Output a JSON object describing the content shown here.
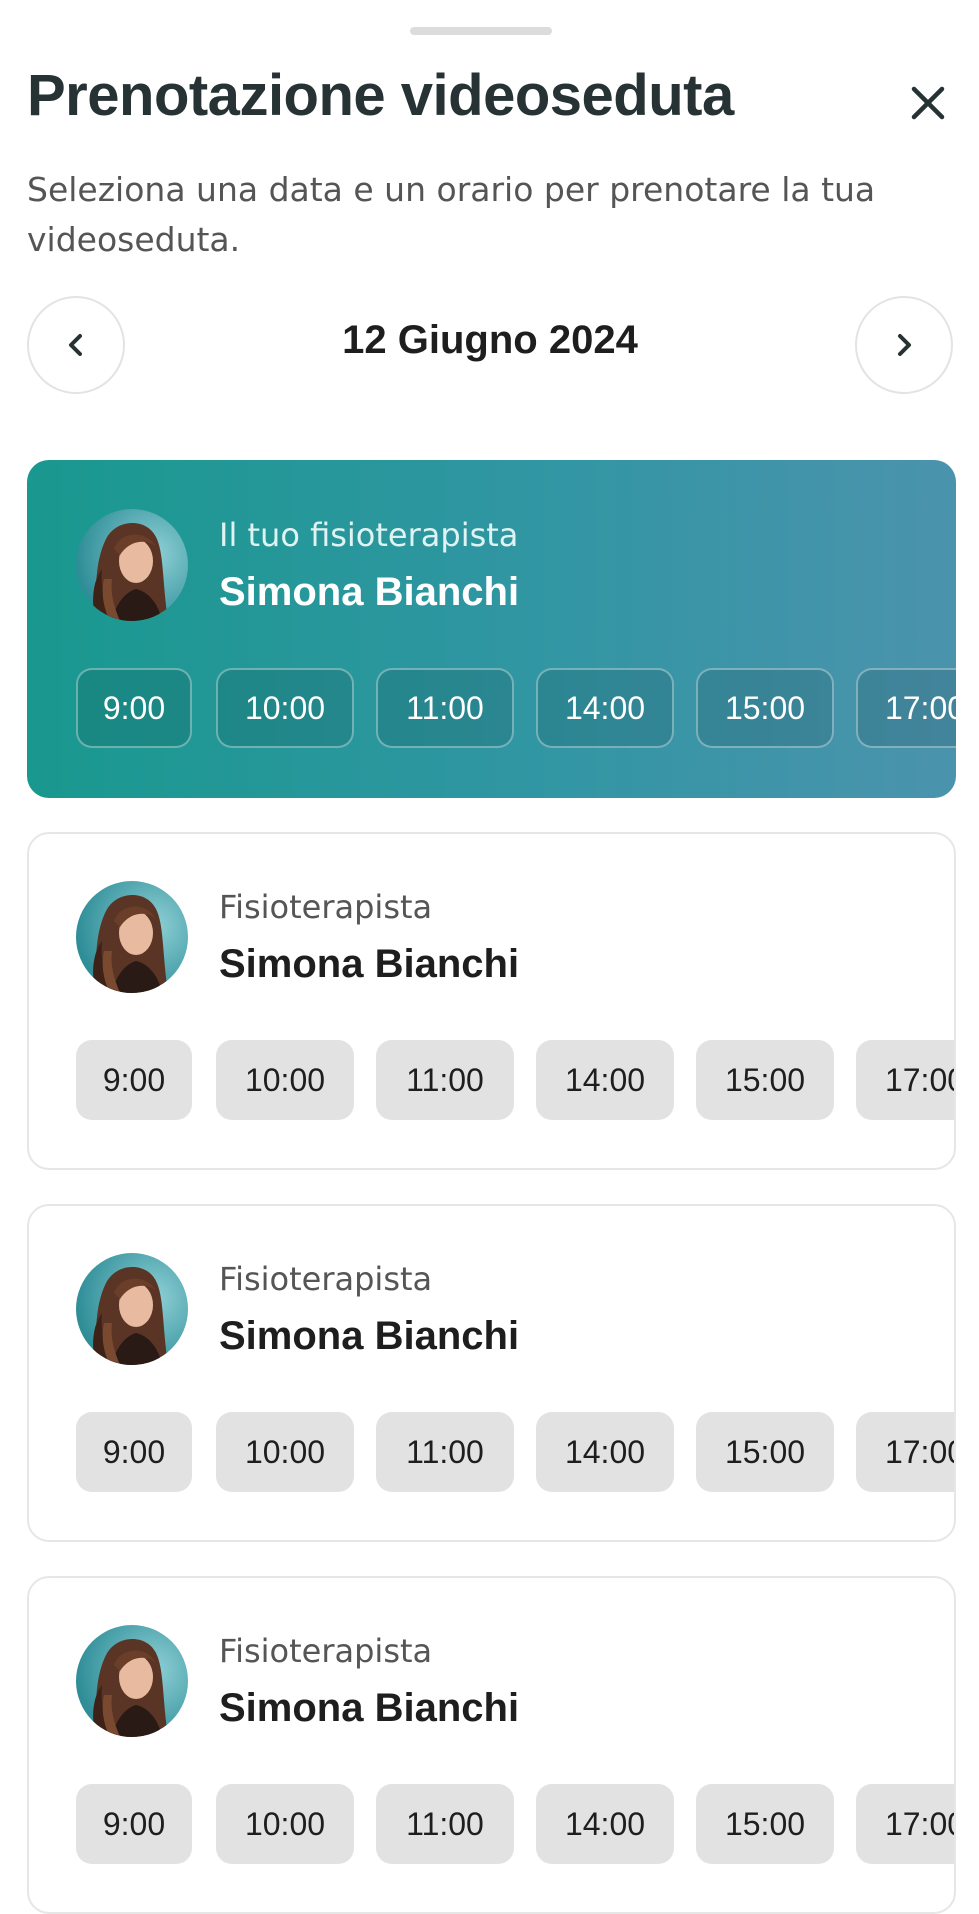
{
  "header": {
    "title": "Prenotazione videoseduta",
    "subtitle": "Seleziona una data e un orario per prenotare la tua videoseduta."
  },
  "date_nav": {
    "date_label": "12 Giugno 2024"
  },
  "cards": [
    {
      "role": "Il tuo fisioterapista",
      "name": "Simona Bianchi",
      "featured": true,
      "slots": [
        "9:00",
        "10:00",
        "11:00",
        "14:00",
        "15:00",
        "17:00"
      ]
    },
    {
      "role": "Fisioterapista",
      "name": "Simona Bianchi",
      "featured": false,
      "slots": [
        "9:00",
        "10:00",
        "11:00",
        "14:00",
        "15:00",
        "17:00"
      ]
    },
    {
      "role": "Fisioterapista",
      "name": "Simona Bianchi",
      "featured": false,
      "slots": [
        "9:00",
        "10:00",
        "11:00",
        "14:00",
        "15:00",
        "17:00"
      ]
    },
    {
      "role": "Fisioterapista",
      "name": "Simona Bianchi",
      "featured": false,
      "slots": [
        "9:00",
        "10:00",
        "11:00",
        "14:00",
        "15:00",
        "17:00"
      ]
    }
  ],
  "colors": {
    "accent_start": "#19988f",
    "accent_end": "#4b93ad",
    "slot_bg": "#e2e2e2"
  },
  "icons": {
    "close": "close-icon",
    "prev": "chevron-left-icon",
    "next": "chevron-right-icon"
  }
}
